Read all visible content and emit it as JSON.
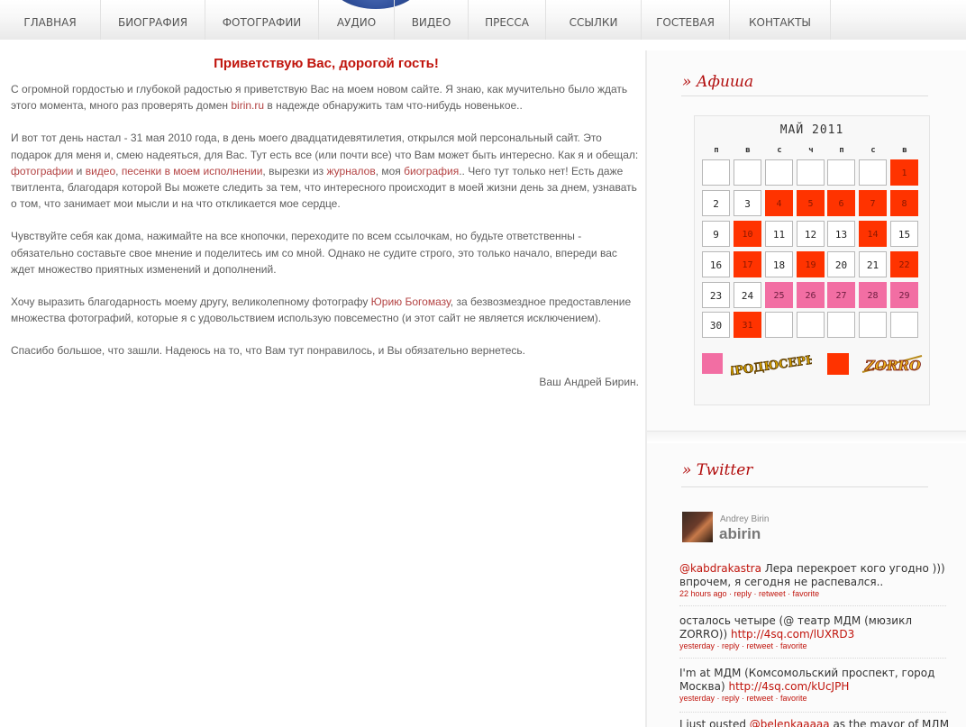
{
  "nav": {
    "items": [
      "ГЛАВНАЯ",
      "БИОГРАФИЯ",
      "ФОТОГРАФИИ",
      "АУДИО",
      "ВИДЕО",
      "ПРЕССА",
      "ССЫЛКИ",
      "ГОСТЕВАЯ",
      "КОНТАКТЫ"
    ]
  },
  "main": {
    "title": "Приветствую Вас, дорогой гость!",
    "p1": {
      "a": "С огромной гордостью и глубокой радостью я приветствую Вас на моем новом сайте. Я знаю, как мучительно было ждать этого момента, много раз проверять домен ",
      "link": "birin.ru",
      "b": " в надежде обнаружить там что-нибудь новенькое.."
    },
    "p2": {
      "a": "И вот тот день настал - 31 мая 2010 года, в день моего двадцатидевятилетия, открылся мой персональный сайт. Это подарок для меня и, смею надеяться, для Вас. Тут есть все (или почти все) что Вам может быть интересно. Как я и обещал: ",
      "link_photos": "фотографии",
      "and": " и ",
      "link_video": "видео",
      "comma": ", ",
      "link_songs": "песенки в моем исполнении",
      "mid": ", вырезки из ",
      "link_journals": "журналов",
      "mid2": ", моя ",
      "link_bio": "биография",
      "b": ".. Чего тут только нет! Есть даже твитлента, благодаря которой Вы можете следить за тем, что интересного происходит в моей жизни день за днем, узнавать о том, что занимает мои мысли и на что откликается мое сердце."
    },
    "p3": "Чувствуйте себя как дома, нажимайте на все кнопочки, переходите по всем ссылочкам, но будьте ответственны - обязательно составьте свое мнение и поделитесь им со мной. Однако не судите строго, это только начало, впереди вас ждет множество приятных изменений и дополнений.",
    "p4": {
      "a": "Хочу выразить благодарность моему другу, великолепному фотографу ",
      "link": "Юрию Богомазу",
      "b": ", за безвозмездное предоставление множества фотографий, которые я с удовольствием использую повсеместно (и этот сайт не является исключением)."
    },
    "p5": "Спасибо большое, что зашли. Надеюсь на то, что Вам тут понравилось, и Вы обязательно вернетесь.",
    "signature": "Ваш Андрей Бирин."
  },
  "afisha": {
    "title": "» Афиша",
    "month": "МАЙ 2011",
    "weekdays": [
      "п",
      "в",
      "с",
      "ч",
      "п",
      "с",
      "в"
    ],
    "weeks": [
      [
        "",
        "",
        "",
        "",
        "",
        "",
        "1"
      ],
      [
        "2",
        "3",
        "4",
        "5",
        "6",
        "7",
        "8"
      ],
      [
        "9",
        "10",
        "11",
        "12",
        "13",
        "14",
        "15"
      ],
      [
        "16",
        "17",
        "18",
        "19",
        "20",
        "21",
        "22"
      ],
      [
        "23",
        "24",
        "25",
        "26",
        "27",
        "28",
        "29"
      ],
      [
        "30",
        "31",
        "",
        "",
        "",
        "",
        ""
      ]
    ],
    "red_days": [
      "1",
      "4",
      "5",
      "6",
      "7",
      "8",
      "10",
      "14",
      "17",
      "19",
      "22",
      "31"
    ],
    "pink_days": [
      "25",
      "26",
      "27",
      "28",
      "29"
    ],
    "colors": {
      "red": "#ff3300",
      "pink": "#f26ea3"
    },
    "legend": {
      "producers_logo_text": "ПРОДЮСЕРЫ",
      "zorro_logo_text": "ZORRO"
    }
  },
  "twitter": {
    "title": "» Twitter",
    "name": "Andrey Birin",
    "handle": "abirin",
    "tweets": [
      {
        "mention": "@kabdrakastra",
        "text": " Лера перекроет кого угодно ))) впрочем, я сегодня не распевался..",
        "link": "",
        "time": "22 hours ago",
        "meta": " · reply · retweet · favorite"
      },
      {
        "mention": "",
        "text": "осталось четыре (@ театр МДМ (мюзикл ZORRO)) ",
        "link": "http://4sq.com/lUXRD3",
        "time": "yesterday",
        "meta": " · reply · retweet · favorite"
      },
      {
        "mention": "",
        "text": "I'm at МДМ (Комсомольский проспект, город Москва) ",
        "link": "http://4sq.com/kUcJPH",
        "time": "yesterday",
        "meta": " · reply · retweet · favorite"
      },
      {
        "pre": "I just ousted ",
        "mention": "@belenkaaaaa",
        "text": " as the mayor of МДМ"
      }
    ]
  }
}
